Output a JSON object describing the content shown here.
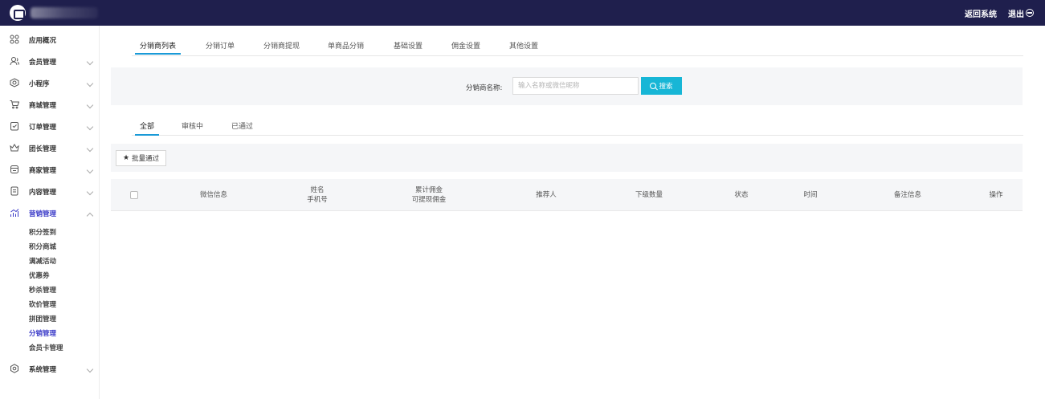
{
  "topbar": {
    "back_label": "返回系统",
    "logout_label": "退出"
  },
  "sidebar": {
    "items": [
      {
        "label": "应用概况",
        "icon": "grid-icon"
      },
      {
        "label": "会员管理",
        "icon": "users-icon"
      },
      {
        "label": "小程序",
        "icon": "miniprogram-icon"
      },
      {
        "label": "商城管理",
        "icon": "cart-icon"
      },
      {
        "label": "订单管理",
        "icon": "order-icon"
      },
      {
        "label": "团长管理",
        "icon": "crown-icon"
      },
      {
        "label": "商家管理",
        "icon": "store-icon"
      },
      {
        "label": "内容管理",
        "icon": "document-icon"
      },
      {
        "label": "营销管理",
        "icon": "chart-icon"
      },
      {
        "label": "系统管理",
        "icon": "gear-icon"
      }
    ],
    "marketing_sub": [
      "积分签到",
      "积分商城",
      "满减活动",
      "优惠券",
      "秒杀管理",
      "砍价管理",
      "拼团管理",
      "分销管理",
      "会员卡管理"
    ]
  },
  "tabs": [
    "分销商列表",
    "分销订单",
    "分销商提现",
    "单商品分销",
    "基础设置",
    "佣金设置",
    "其他设置"
  ],
  "search": {
    "label": "分销商名称:",
    "placeholder": "输入名称或微信昵称",
    "button": "搜索"
  },
  "status_tabs": [
    "全部",
    "审核中",
    "已通过"
  ],
  "batch": {
    "button": "批量通过"
  },
  "table": {
    "columns": [
      {
        "line1": "微信信息",
        "line2": ""
      },
      {
        "line1": "姓名",
        "line2": "手机号"
      },
      {
        "line1": "累计佣金",
        "line2": "可提现佣金"
      },
      {
        "line1": "推荐人",
        "line2": ""
      },
      {
        "line1": "下级数量",
        "line2": ""
      },
      {
        "line1": "状态",
        "line2": ""
      },
      {
        "line1": "时间",
        "line2": ""
      },
      {
        "line1": "备注信息",
        "line2": ""
      },
      {
        "line1": "操作",
        "line2": ""
      }
    ]
  },
  "colors": {
    "topbar": "#1f1f4d",
    "accent": "#1a9ad7",
    "search_button": "#17b6d6",
    "active_menu": "#3b3bc8"
  }
}
